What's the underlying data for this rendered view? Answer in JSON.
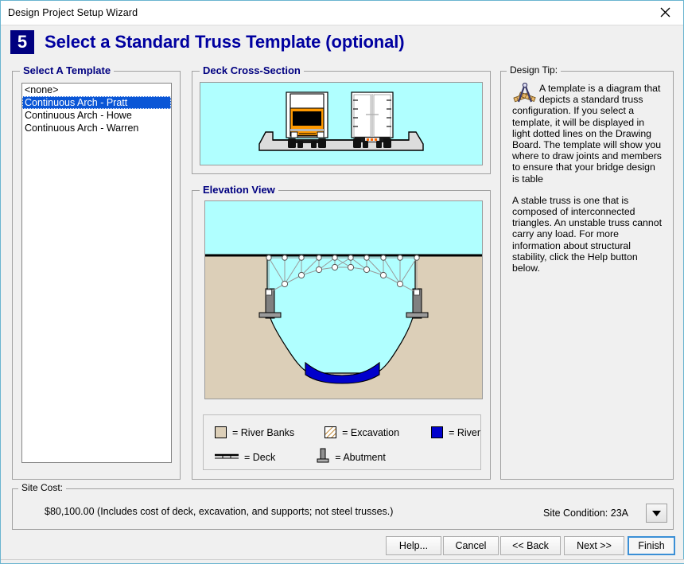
{
  "window": {
    "title": "Design Project Setup Wizard",
    "close_icon": "close-icon"
  },
  "header": {
    "step_number": "5",
    "title": "Select a Standard Truss Template (optional)"
  },
  "template_panel": {
    "label": "Select A Template",
    "items": [
      {
        "label": "<none>",
        "selected": false
      },
      {
        "label": "Continuous Arch - Pratt",
        "selected": true
      },
      {
        "label": "Continuous Arch - Howe",
        "selected": false
      },
      {
        "label": "Continuous Arch - Warren",
        "selected": false
      }
    ]
  },
  "deck_section": {
    "label": "Deck Cross-Section"
  },
  "elevation_section": {
    "label": "Elevation View",
    "legend": [
      {
        "swatch": "river-banks-swatch",
        "text": "= River Banks",
        "color": "#DCCFB8"
      },
      {
        "swatch": "excavation-swatch",
        "text": "= Excavation",
        "color": "#FFFFFF"
      },
      {
        "swatch": "river-swatch",
        "text": "= River",
        "color": "#0000CC"
      },
      {
        "swatch": "deck-swatch",
        "text": "= Deck",
        "color": "#000000"
      },
      {
        "swatch": "abutment-swatch",
        "text": "= Abutment",
        "color": "#808080"
      }
    ]
  },
  "design_tip": {
    "label": "Design Tip:",
    "icon": "compass-square-icon",
    "paragraph1": "A template is a diagram that depicts a standard truss configuration. If you select a template, it will be displayed in light dotted lines on the Drawing Board. The template will show you where to draw joints and members to ensure that your bridge design is table",
    "paragraph2": "A stable truss is one that is composed of interconnected triangles. An unstable truss cannot carry any load. For more information about structural stability, click the Help button below."
  },
  "site_cost": {
    "label": "Site Cost:",
    "amount_text": "$80,100.00  (Includes cost of deck, excavation, and supports; not steel trusses.)",
    "site_condition_label": "Site Condition: 23A",
    "dropdown_icon": "chevron-down-icon"
  },
  "buttons": {
    "help": "Help...",
    "cancel": "Cancel",
    "back": "<< Back",
    "next": "Next >>",
    "finish": "Finish"
  },
  "colors": {
    "title_accent": "#000080",
    "sky_water": "#B0FFFF",
    "earth": "#DCCFB8",
    "river": "#0000CC",
    "selection": "#0A56D6",
    "truck_body": "#FF9900"
  }
}
